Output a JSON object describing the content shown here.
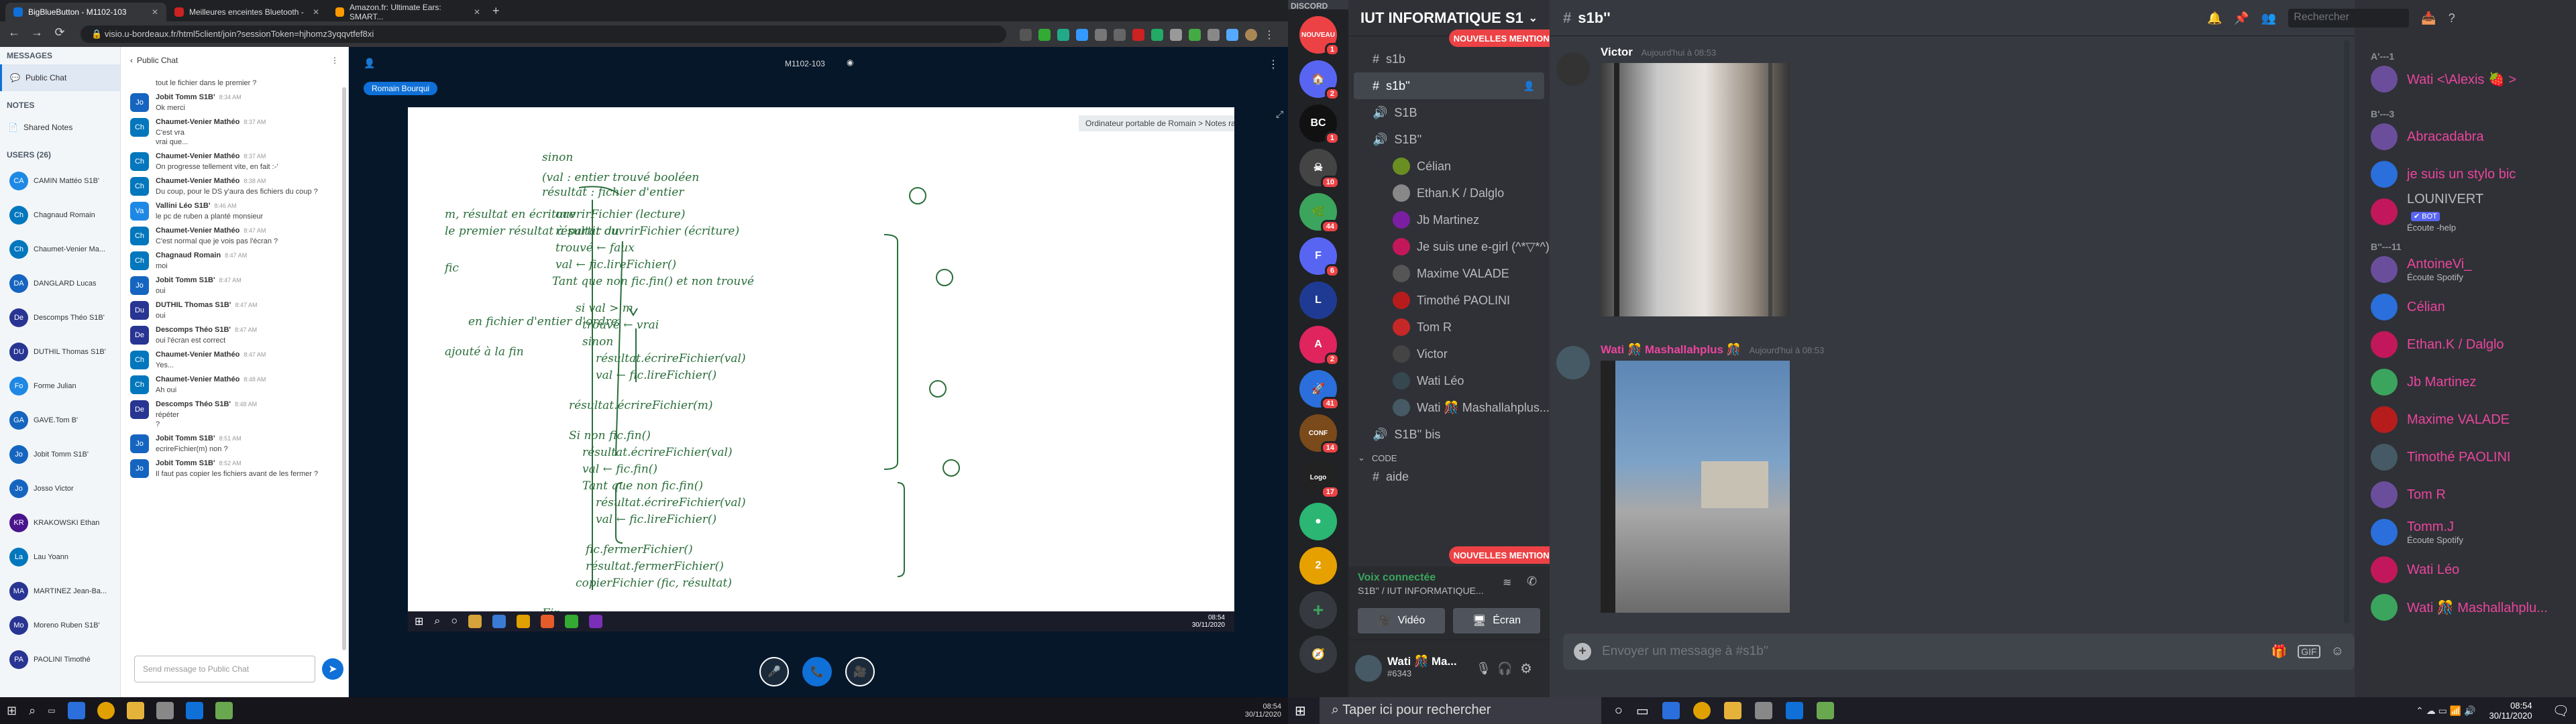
{
  "browser": {
    "tabs": [
      {
        "title": "BigBlueButton - M1102-103",
        "active": true
      },
      {
        "title": "Meilleures enceintes Bluetooth -",
        "active": false
      },
      {
        "title": "Amazon.fr: Ultimate Ears: SMART...",
        "active": false
      }
    ],
    "new_tab": "+",
    "url": "visio.u-bordeaux.fr/html5client/join?sessionToken=hjhomz3yqqvtfef8xi"
  },
  "bbb": {
    "sidebar": {
      "messages_title": "MESSAGES",
      "public_chat": "Public Chat",
      "notes_title": "NOTES",
      "shared_notes": "Shared Notes",
      "users_title": "USERS (26)",
      "users": [
        {
          "initials": "CA",
          "name": "CAMIN Mattéo S1B'",
          "color": "#1e88e5"
        },
        {
          "initials": "Ch",
          "name": "Chagnaud Romain",
          "color": "#0277bd"
        },
        {
          "initials": "Ch",
          "name": "Chaumet-Venier Ma...",
          "color": "#0277bd"
        },
        {
          "initials": "DA",
          "name": "DANGLARD Lucas",
          "color": "#1565c0"
        },
        {
          "initials": "De",
          "name": "Descomps Théo S1B'",
          "color": "#283593"
        },
        {
          "initials": "DU",
          "name": "DUTHIL Thomas S1B'",
          "color": "#283593"
        },
        {
          "initials": "Fo",
          "name": "Forme Julian",
          "color": "#1e88e5"
        },
        {
          "initials": "GA",
          "name": "GAVE.Tom B'",
          "color": "#1565c0"
        },
        {
          "initials": "Jo",
          "name": "Jobit Tomm S1B'",
          "color": "#1565c0"
        },
        {
          "initials": "Jo",
          "name": "Josso Victor",
          "color": "#1565c0"
        },
        {
          "initials": "KR",
          "name": "KRAKOWSKI Ethan",
          "color": "#4a148c"
        },
        {
          "initials": "La",
          "name": "Lau Yoann",
          "color": "#0277bd"
        },
        {
          "initials": "MA",
          "name": "MARTINEZ Jean-Ba...",
          "color": "#283593"
        },
        {
          "initials": "Mo",
          "name": "Moreno Ruben S1B'",
          "color": "#283593"
        },
        {
          "initials": "PA",
          "name": "PAOLINI Timothé",
          "color": "#283593"
        }
      ]
    },
    "chat": {
      "header": "Public Chat",
      "top_partial": "tout le fichier dans le premier ?",
      "messages": [
        {
          "initials": "Jo",
          "name": "Jobit Tomm S1B'",
          "time": "8:34 AM",
          "text": "Ok merci",
          "color": "#1565c0"
        },
        {
          "initials": "Ch",
          "name": "Chaumet-Venier Mathéo",
          "time": "8:37 AM",
          "text": "C'est vra\nvrai que...",
          "color": "#0277bd"
        },
        {
          "initials": "Ch",
          "name": "Chaumet-Venier Mathéo",
          "time": "8:37 AM",
          "text": "On progresse tellement vite, en fait :-'",
          "color": "#0277bd"
        },
        {
          "initials": "Ch",
          "name": "Chaumet-Venier Mathéo",
          "time": "8:38 AM",
          "text": "Du coup, pour le DS y'aura des fichiers du coup ?",
          "color": "#0277bd"
        },
        {
          "initials": "Va",
          "name": "Vallini Léo S1B'",
          "time": "8:46 AM",
          "text": "le pc de ruben a planté monsieur",
          "color": "#1e88e5"
        },
        {
          "initials": "Ch",
          "name": "Chaumet-Venier Mathéo",
          "time": "8:47 AM",
          "text": "C'est normal que je vois pas l'écran ?",
          "color": "#0277bd"
        },
        {
          "initials": "Ch",
          "name": "Chagnaud Romain",
          "time": "8:47 AM",
          "text": "moi",
          "color": "#0277bd"
        },
        {
          "initials": "Jo",
          "name": "Jobit Tomm S1B'",
          "time": "8:47 AM",
          "text": "oui",
          "color": "#1565c0"
        },
        {
          "initials": "Du",
          "name": "DUTHIL Thomas S1B'",
          "time": "8:47 AM",
          "text": "oui",
          "color": "#283593"
        },
        {
          "initials": "De",
          "name": "Descomps Théo S1B'",
          "time": "8:47 AM",
          "text": "oui l'écran est correct",
          "color": "#283593"
        },
        {
          "initials": "Ch",
          "name": "Chaumet-Venier Mathéo",
          "time": "8:47 AM",
          "text": "Yes...",
          "color": "#0277bd"
        },
        {
          "initials": "Ch",
          "name": "Chaumet-Venier Mathéo",
          "time": "8:48 AM",
          "text": "Ah oui",
          "color": "#0277bd"
        },
        {
          "initials": "De",
          "name": "Descomps Théo S1B'",
          "time": "8:48 AM",
          "text": "répéter\n?",
          "color": "#283593"
        },
        {
          "initials": "Jo",
          "name": "Jobit Tomm S1B'",
          "time": "8:51 AM",
          "text": "ecrireFichier(m) non ?",
          "color": "#1565c0"
        },
        {
          "initials": "Jo",
          "name": "Jobit Tomm S1B'",
          "time": "8:52 AM",
          "text": "Il faut pas copier les fichiers avant de les fermer ?",
          "color": "#1565c0"
        }
      ],
      "input_placeholder": "Send message to Public Chat"
    },
    "presentation": {
      "room_title": "M1102-103",
      "presenter": "Romain Bourqui",
      "ppt_label": "Ordinateur portable de Romain > Notes rapides",
      "inner_clock": "08:54\n30/11/2020",
      "whiteboard_lines": [
        "sinon",
        "(val : entier trouvé booléen",
        "résultat : fichier d'entier",
        "ouvrirFichier (lecture)",
        "résultat ouvrirFichier (écriture)",
        "trouvé ← faux",
        "val ← fic.lireFichier()",
        "Tant que non fic.fin() et non trouvé",
        "si val > m",
        "trouvé ← vrai",
        "sinon",
        "résultat.écrireFichier(val)",
        "val ← fic.lireFichier()",
        "résultat.écrireFichier(m)",
        "Si non fic.fin()",
        "résultat.écrireFichier(val)",
        "val ← fic.fin()",
        "Tant que non fic.fin()",
        "résultat.écrireFichier(val)",
        "val ← fic.lireFichier()",
        "fic.fermerFichier()",
        "résultat.fermerFichier()",
        "copierFichier (fic, résultat)",
        "Fin",
        "m, résultat en écriture",
        "le premier résultat à partir du",
        "fic",
        "en fichier d'entier d'ordre",
        "ajouté à la fin"
      ]
    },
    "taskbar": {
      "time": "08:54",
      "date": "30/11/2020"
    }
  },
  "discord": {
    "app_label": "DISCORD",
    "guilds": [
      {
        "label": "NOUVEAU",
        "color": "#ed4245",
        "badge": "1"
      },
      {
        "label": "🏠",
        "color": "#5865f2",
        "badge": "2"
      },
      {
        "label": "BC",
        "color": "#111",
        "badge": "1"
      },
      {
        "label": "☠",
        "color": "#444",
        "badge": "10"
      },
      {
        "label": "🌿",
        "color": "#3ba55d",
        "badge": "44"
      },
      {
        "label": "F",
        "color": "#5865f2",
        "badge": "6"
      },
      {
        "label": "L",
        "color": "#1f3a93",
        "badge": ""
      },
      {
        "label": "A",
        "color": "#e0245e",
        "badge": "2"
      },
      {
        "label": "🚀",
        "color": "#2a6fdb",
        "badge": "41"
      },
      {
        "label": "CONF",
        "color": "#7a4a1a",
        "badge": "14"
      },
      {
        "label": "Logo",
        "color": "#222",
        "badge": "17"
      },
      {
        "label": "●",
        "color": "#2bb673",
        "badge": ""
      },
      {
        "label": "2",
        "color": "#e6a100",
        "badge": ""
      }
    ],
    "add_server": "+",
    "explore": "🧭",
    "server_name": "IUT INFORMATIQUE S1",
    "new_mentions": "NOUVELLES MENTIONS",
    "channels": [
      {
        "name": "s1b",
        "kind": "text"
      },
      {
        "name": "s1b''",
        "kind": "text",
        "selected": true
      },
      {
        "name": "S1B",
        "kind": "voice"
      },
      {
        "name": "S1B''",
        "kind": "voice"
      }
    ],
    "voice_members": [
      {
        "name": "Célian",
        "color": "#6b8e23"
      },
      {
        "name": "Ethan.K / Dalglo",
        "color": "#888"
      },
      {
        "name": "Jb Martinez",
        "color": "#7b1fa2"
      },
      {
        "name": "Je suis une e-girl (^*▽*^)",
        "color": "#c2185b"
      },
      {
        "name": "Maxime VALADE",
        "color": "#555"
      },
      {
        "name": "Timothé PAOLINI",
        "color": "#b71c1c"
      },
      {
        "name": "Tom R",
        "color": "#c62828"
      },
      {
        "name": "Victor",
        "color": "#444"
      },
      {
        "name": "Wati Léo",
        "color": "#37474f"
      },
      {
        "name": "Wati 🎊 Mashallahplus...",
        "color": "#455a64"
      }
    ],
    "bis_channel": "S1B'' bis",
    "code_category": "CODE",
    "aide_channel": "aide",
    "voice": {
      "status": "Voix connectée",
      "channel": "S1B'' / IUT INFORMATIQUE...",
      "video": "Vidéo",
      "screen": "Écran"
    },
    "me": {
      "name": "Wati 🎊 Ma...",
      "tag": "#6343"
    },
    "channel_header": "s1b''",
    "search_placeholder": "Rechercher",
    "posts": [
      {
        "author": "Victor",
        "time": "Aujourd'hui à 08:53",
        "color": "#fff"
      },
      {
        "author": "Wati 🎊 Mashallahplus 🎊",
        "time": "Aujourd'hui à 08:53",
        "color": "#eb459e"
      }
    ],
    "composer_placeholder": "Envoyer un message à #s1b''",
    "members": {
      "groups": [
        {
          "title": "A'---1",
          "items": [
            {
              "name": "Wati <\\Alexis 🍓 >",
              "sub": "",
              "color": "#eb459e"
            }
          ]
        },
        {
          "title": "B'---3",
          "items": [
            {
              "name": "Abracadabra",
              "sub": "",
              "color": "#eb459e"
            },
            {
              "name": "je suis un stylo bic",
              "sub": "",
              "color": "#eb459e"
            },
            {
              "name": "LOUNIVERT",
              "sub": "Écoute -help",
              "color": "#b9bbbe",
              "bot": "✔ BOT"
            }
          ]
        },
        {
          "title": "B''---11",
          "items": [
            {
              "name": "AntoineVi_",
              "sub": "Écoute Spotify",
              "color": "#eb459e"
            },
            {
              "name": "Célian",
              "sub": "",
              "color": "#eb459e"
            },
            {
              "name": "Ethan.K / Dalglo",
              "sub": "",
              "color": "#eb459e"
            },
            {
              "name": "Jb Martinez",
              "sub": "",
              "color": "#eb459e"
            },
            {
              "name": "Maxime VALADE",
              "sub": "",
              "color": "#eb459e"
            },
            {
              "name": "Timothé PAOLINI",
              "sub": "",
              "color": "#eb459e"
            },
            {
              "name": "Tom R",
              "sub": "",
              "color": "#eb459e"
            },
            {
              "name": "Tomm.J",
              "sub": "Écoute Spotify",
              "color": "#eb459e"
            },
            {
              "name": "Wati Léo",
              "sub": "",
              "color": "#eb459e"
            },
            {
              "name": "Wati 🎊 Mashallahplu...",
              "sub": "",
              "color": "#eb459e"
            }
          ]
        }
      ]
    },
    "taskbar": {
      "search": "Taper ici pour rechercher",
      "time": "08:54",
      "date": "30/11/2020"
    }
  }
}
